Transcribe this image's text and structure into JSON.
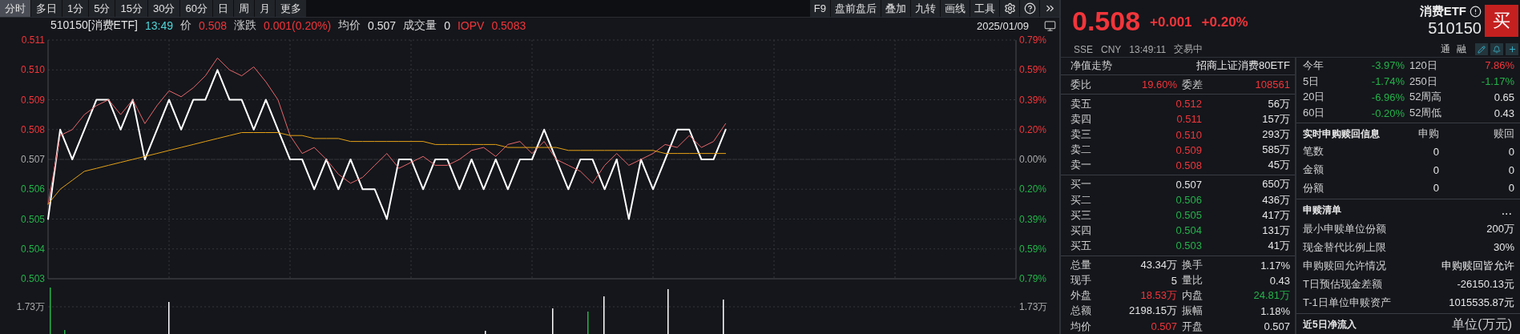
{
  "tabs": [
    {
      "label": "分时",
      "selected": true
    },
    {
      "label": "多日",
      "selected": false
    },
    {
      "label": "1分",
      "selected": false
    },
    {
      "label": "5分",
      "selected": false
    },
    {
      "label": "15分",
      "selected": false
    },
    {
      "label": "30分",
      "selected": false
    },
    {
      "label": "60分",
      "selected": false
    },
    {
      "label": "日",
      "selected": false
    },
    {
      "label": "周",
      "selected": false
    },
    {
      "label": "月",
      "selected": false
    },
    {
      "label": "更多",
      "selected": false
    }
  ],
  "tools": [
    "F9",
    "盘前盘后",
    "叠加",
    "九转",
    "画线",
    "工具"
  ],
  "quote_line": {
    "symbol": "510150[消费ETF]",
    "time": "13:49",
    "items": [
      {
        "kind": "plain",
        "label": "价",
        "value": "0.508",
        "color": "#f2353a"
      },
      {
        "kind": "plain",
        "label": "涨跌",
        "value": "0.001(0.20%)",
        "color": "#f2353a"
      },
      {
        "kind": "plain",
        "label": "均价",
        "value": "0.507",
        "color": "#e4e4e4"
      },
      {
        "kind": "plain",
        "label": "成交量",
        "value": "0",
        "color": "#e4e4e4"
      },
      {
        "kind": "iopv",
        "label": "IOPV",
        "value": "0.5083",
        "color": "#f2353a"
      }
    ]
  },
  "date": "2025/01/09",
  "chart": {
    "right_ticks": [
      {
        "label": "0.79%",
        "color": "#f2353a"
      },
      {
        "label": "0.59%",
        "color": "#f2353a"
      },
      {
        "label": "0.39%",
        "color": "#f2353a"
      },
      {
        "label": "0.20%",
        "color": "#f2353a"
      },
      {
        "label": "0.00%",
        "color": "#aaaaaa"
      },
      {
        "label": "0.20%",
        "color": "#25b34a"
      },
      {
        "label": "0.39%",
        "color": "#25b34a"
      },
      {
        "label": "0.59%",
        "color": "#25b34a"
      },
      {
        "label": "0.79%",
        "color": "#25b34a"
      }
    ],
    "volume_label_left": "1.73万",
    "volume_label_right": "1.73万",
    "chart_data": {
      "type": "line",
      "grid": true,
      "ylim": [
        0.503,
        0.511
      ],
      "yticks": [
        {
          "value": 0.503,
          "label": "0.503"
        },
        {
          "value": 0.504,
          "label": "0.504"
        },
        {
          "value": 0.505,
          "label": "0.505"
        },
        {
          "value": 0.506,
          "label": "0.506"
        },
        {
          "value": 0.507,
          "label": "0.507"
        },
        {
          "value": 0.508,
          "label": "0.508"
        },
        {
          "value": 0.509,
          "label": "0.509"
        },
        {
          "value": 0.51,
          "label": "0.510"
        },
        {
          "value": 0.511,
          "label": "0.511"
        }
      ],
      "categories": [
        null,
        null,
        null,
        null,
        null,
        null,
        null,
        null,
        null,
        null,
        null,
        null,
        null,
        null,
        null,
        null,
        null,
        null,
        null,
        null,
        null,
        null,
        null,
        null,
        null,
        null,
        null,
        null,
        null,
        null,
        null,
        null,
        null,
        null,
        null,
        null,
        null,
        null,
        null,
        null,
        null,
        null,
        null,
        null,
        null,
        null,
        null,
        null,
        null,
        null,
        null,
        null,
        null,
        null,
        null,
        null,
        null,
        null,
        null,
        null,
        null,
        null,
        null,
        null,
        null,
        null,
        null,
        null,
        null,
        null,
        null,
        null,
        null,
        null,
        null,
        null,
        null,
        null,
        null,
        null
      ],
      "series": [
        {
          "color": "#ffffff",
          "values": [
            0.505,
            0.508,
            0.507,
            0.508,
            0.509,
            0.509,
            0.508,
            0.509,
            0.507,
            0.508,
            0.509,
            0.508,
            0.509,
            0.509,
            0.51,
            0.509,
            0.509,
            0.508,
            0.509,
            0.508,
            0.507,
            0.507,
            0.506,
            0.507,
            0.506,
            0.507,
            0.506,
            0.506,
            0.505,
            0.507,
            0.507,
            0.506,
            0.507,
            0.507,
            0.506,
            0.507,
            0.506,
            0.507,
            0.506,
            0.507,
            0.507,
            0.508,
            0.507,
            0.506,
            0.507,
            0.507,
            0.506,
            0.507,
            0.505,
            0.507,
            0.506,
            0.507,
            0.508,
            0.508,
            0.507,
            0.507,
            0.508,
            null,
            null,
            null,
            null,
            null,
            null,
            null,
            null,
            null,
            null,
            null,
            null,
            null,
            null,
            null,
            null,
            null,
            null,
            null,
            null,
            null,
            null,
            null
          ]
        },
        {
          "color": "#e8676b",
          "values": [
            0.5055,
            0.5078,
            0.508,
            0.5085,
            0.5088,
            0.509,
            0.5085,
            0.509,
            0.5082,
            0.5088,
            0.5093,
            0.5091,
            0.5094,
            0.5098,
            0.5104,
            0.51,
            0.5098,
            0.5101,
            0.5096,
            0.509,
            0.5078,
            0.5072,
            0.5074,
            0.507,
            0.5065,
            0.5062,
            0.5064,
            0.5068,
            0.5072,
            0.5067,
            0.5069,
            0.5071,
            0.5068,
            0.5068,
            0.507,
            0.5073,
            0.5074,
            0.5071,
            0.5075,
            0.5076,
            0.5072,
            0.5076,
            0.507,
            0.5068,
            0.5066,
            0.5062,
            0.5068,
            0.5072,
            0.5068,
            0.507,
            0.5072,
            0.5075,
            0.5074,
            0.5078,
            0.5074,
            0.5076,
            0.5082,
            null,
            null,
            null,
            null,
            null,
            null,
            null,
            null,
            null,
            null,
            null,
            null,
            null,
            null,
            null,
            null,
            null,
            null,
            null,
            null,
            null,
            null,
            null
          ]
        },
        {
          "color": "#e6a117",
          "values": [
            0.5055,
            0.506,
            0.5063,
            0.5066,
            0.5067,
            0.5068,
            0.5069,
            0.507,
            0.5071,
            0.5072,
            0.5073,
            0.5074,
            0.5075,
            0.5076,
            0.5077,
            0.5078,
            0.5079,
            0.5079,
            0.5079,
            0.5079,
            0.5078,
            0.5078,
            0.5077,
            0.5077,
            0.5077,
            0.5076,
            0.5076,
            0.5076,
            0.5076,
            0.5076,
            0.5076,
            0.5076,
            0.5075,
            0.5075,
            0.5075,
            0.5075,
            0.5075,
            0.5075,
            0.5074,
            0.5074,
            0.5074,
            0.5074,
            0.5074,
            0.5073,
            0.5073,
            0.5073,
            0.5073,
            0.5073,
            0.5073,
            0.5073,
            0.5073,
            0.5072,
            0.5072,
            0.5072,
            0.5072,
            0.5072,
            0.5072,
            null,
            null,
            null,
            null,
            null,
            null,
            null,
            null,
            null,
            null,
            null,
            null,
            null,
            null,
            null,
            null,
            null,
            null,
            null,
            null,
            null,
            null,
            null
          ]
        }
      ]
    }
  },
  "quote": {
    "price": "0.508",
    "change": "+0.001",
    "change_pct": "+0.20%",
    "color": "#f2353a",
    "name": "消费ETF",
    "code": "510150",
    "buy_label": "买",
    "exchange": "SSE",
    "currency": "CNY",
    "time": "13:49:11",
    "status": "交易中",
    "badges": [
      "通",
      "融"
    ]
  },
  "nav": {
    "label": "净值走势",
    "fund": "招商上证消费80ETF"
  },
  "commission": [
    {
      "label": "委比",
      "value": "19.60%",
      "color": "#f2353a"
    },
    {
      "label": "委差",
      "value": "108561",
      "color": "#f2353a"
    }
  ],
  "asks": [
    {
      "label": "卖五",
      "price": "0.512",
      "volume": "56万",
      "color": "#f2353a"
    },
    {
      "label": "卖四",
      "price": "0.511",
      "volume": "157万",
      "color": "#f2353a"
    },
    {
      "label": "卖三",
      "price": "0.510",
      "volume": "293万",
      "color": "#f2353a"
    },
    {
      "label": "卖二",
      "price": "0.509",
      "volume": "585万",
      "color": "#f2353a"
    },
    {
      "label": "卖一",
      "price": "0.508",
      "volume": "45万",
      "color": "#f2353a"
    }
  ],
  "bids": [
    {
      "label": "买一",
      "price": "0.507",
      "volume": "650万",
      "color": "#e4e4e4"
    },
    {
      "label": "买二",
      "price": "0.506",
      "volume": "436万",
      "color": "#25b34a"
    },
    {
      "label": "买三",
      "price": "0.505",
      "volume": "417万",
      "color": "#25b34a"
    },
    {
      "label": "买四",
      "price": "0.504",
      "volume": "131万",
      "color": "#25b34a"
    },
    {
      "label": "买五",
      "price": "0.503",
      "volume": "41万",
      "color": "#25b34a"
    }
  ],
  "stats": [
    [
      {
        "label": "总量",
        "value": "43.34万",
        "color": "#e4e4e4"
      },
      {
        "label": "换手",
        "value": "1.17%",
        "color": "#e4e4e4"
      }
    ],
    [
      {
        "label": "现手",
        "value": "5",
        "color": "#e4e4e4"
      },
      {
        "label": "量比",
        "value": "0.43",
        "color": "#e4e4e4"
      }
    ],
    [
      {
        "label": "外盘",
        "value": "18.53万",
        "color": "#f2353a"
      },
      {
        "label": "内盘",
        "value": "24.81万",
        "color": "#25b34a"
      }
    ],
    [
      {
        "label": "总额",
        "value": "2198.15万",
        "color": "#e4e4e4"
      },
      {
        "label": "振幅",
        "value": "1.18%",
        "color": "#e4e4e4"
      }
    ],
    [
      {
        "label": "均价",
        "value": "0.507",
        "color": "#f2353a"
      },
      {
        "label": "开盘",
        "value": "0.507",
        "color": "#e4e4e4"
      }
    ]
  ],
  "performance": [
    {
      "label": "今年",
      "value": "-3.97%",
      "color": "#25b34a"
    },
    {
      "label": "120日",
      "value": "7.86%",
      "color": "#f2353a"
    },
    {
      "label": "5日",
      "value": "-1.74%",
      "color": "#25b34a"
    },
    {
      "label": "250日",
      "value": "-1.17%",
      "color": "#25b34a"
    },
    {
      "label": "20日",
      "value": "-6.96%",
      "color": "#25b34a"
    },
    {
      "label": "52周高",
      "value": "0.65",
      "color": "#e4e4e4"
    },
    {
      "label": "60日",
      "value": "-0.20%",
      "color": "#25b34a"
    },
    {
      "label": "52周低",
      "value": "0.43",
      "color": "#e4e4e4"
    }
  ],
  "creation_redemption": {
    "title": "实时申购赎回信息",
    "columns": [
      "申购",
      "赎回"
    ],
    "rows": [
      {
        "label": "笔数",
        "values": [
          "0",
          "0"
        ]
      },
      {
        "label": "金额",
        "values": [
          "0",
          "0"
        ]
      },
      {
        "label": "份额",
        "values": [
          "0",
          "0"
        ]
      }
    ]
  },
  "basket": {
    "title": "申赎清单",
    "more": "...",
    "rows": [
      {
        "label": "最小申赎单位份额",
        "value": "200万"
      },
      {
        "label": "现金替代比例上限",
        "value": "30%"
      },
      {
        "label": "申购赎回允许情况",
        "value": "申购赎回皆允许"
      },
      {
        "label": "T日预估现金差额",
        "value": "-26150.13元"
      },
      {
        "label": "T-1日单位申赎资产",
        "value": "1015535.87元"
      }
    ]
  },
  "net_inflow": {
    "title": "近5日净流入",
    "unit": "单位(万元)"
  }
}
